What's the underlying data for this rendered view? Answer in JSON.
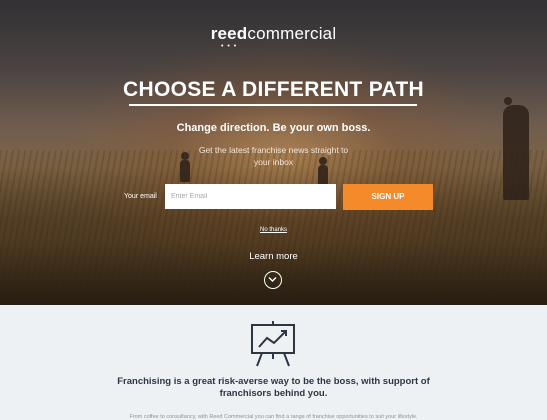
{
  "brand": {
    "logo_bold": "reed",
    "logo_light": "commercial",
    "logo_dots": "• • •"
  },
  "hero": {
    "headline": "CHOOSE A DIFFERENT PATH",
    "subhead": "Change direction. Be your own boss.",
    "intro": "Get the latest franchise news straight to your inbox"
  },
  "signup_form": {
    "email_label": "Your email",
    "email_placeholder": "Enter Email",
    "email_value": "",
    "submit_label": "SIGN UP",
    "decline_label": "No thanks"
  },
  "scroll": {
    "learn_more_label": "Learn more",
    "icon": "chevron-down-icon"
  },
  "feature": {
    "icon": "presentation-chart-icon",
    "title": "Franchising is a great risk-averse way to be the boss, with support of franchisors behind you.",
    "body": "From coffee to consultancy, with Reed Commercial you can find a range of franchise opportunities to suit your lifestyle."
  },
  "colors": {
    "accent": "#f58a2a",
    "heading_text": "#2d3744",
    "lower_background": "#eef1f4"
  }
}
